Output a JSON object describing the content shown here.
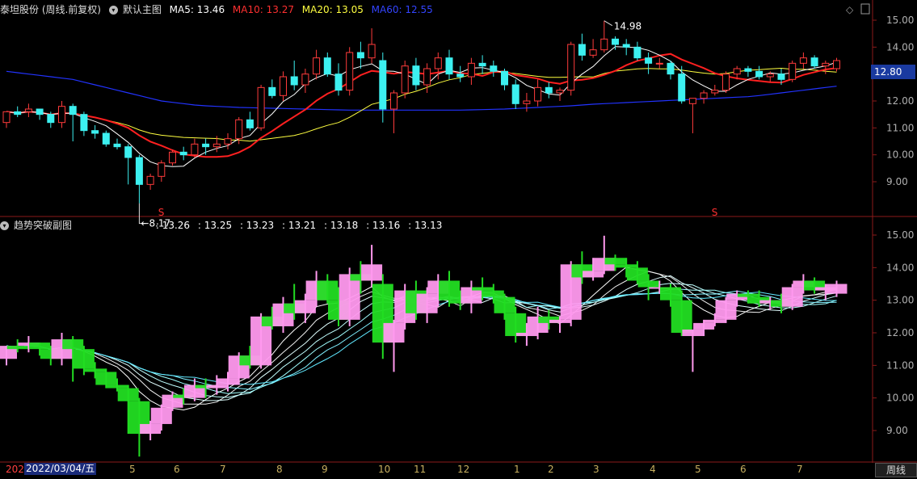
{
  "main_header": {
    "stock_title": "泰坦股份 (周线.前复权)",
    "chart_name": "默认主图",
    "ma5_label": "MA5: 13.46",
    "ma10_label": "MA10: 13.27",
    "ma20_label": "MA20: 13.05",
    "ma60_label": "MA60: 12.55"
  },
  "sub_header": {
    "title": "趋势突破副图",
    "values": [
      ": 13.26",
      ": 13.25",
      ": 13.23",
      ": 13.21",
      ": 13.18",
      ": 13.16",
      ": 13.13"
    ]
  },
  "annotations": {
    "high_label": "14.98",
    "low_label": "8.17",
    "marker": "S"
  },
  "current_price_tag": "12.80",
  "period_button": "周线",
  "date_axis": {
    "selected_date": "2022/03/04/五",
    "year_prefix": "202",
    "month_labels": [
      "5",
      "6",
      "7",
      "8",
      "9",
      "10",
      "11",
      "12",
      "1",
      "2",
      "3",
      "4",
      "5",
      "6",
      "7"
    ]
  },
  "colors": {
    "up": "#ff3b3b",
    "down": "#3cf0f0",
    "ma5": "#ffffff",
    "ma10": "#ff2020",
    "ma20": "#ffff40",
    "ma60": "#2233ff",
    "axis": "#8b1a1a",
    "sub_up": "#ff99ee",
    "sub_down": "#22dd22"
  },
  "chart_data": {
    "type": "candlestick",
    "main_y_ticks": [
      "15.00",
      "14.00",
      "13.00",
      "12.00",
      "11.00",
      "10.00",
      "9.00"
    ],
    "sub_y_ticks": [
      "15.00",
      "14.00",
      "13.00",
      "12.00",
      "11.00",
      "10.00",
      "9.00"
    ],
    "main_ylim": [
      8.0,
      15.6
    ],
    "candles": [
      [
        11.2,
        11.6,
        11.0,
        11.6
      ],
      [
        11.6,
        11.8,
        11.4,
        11.5
      ],
      [
        11.6,
        11.9,
        11.4,
        11.7
      ],
      [
        11.7,
        11.7,
        11.3,
        11.5
      ],
      [
        11.5,
        11.6,
        11.0,
        11.2
      ],
      [
        11.2,
        12.0,
        11.0,
        11.8
      ],
      [
        11.8,
        11.9,
        10.5,
        11.5
      ],
      [
        11.5,
        11.6,
        10.7,
        10.9
      ],
      [
        10.9,
        11.1,
        10.6,
        10.8
      ],
      [
        10.8,
        10.9,
        10.3,
        10.4
      ],
      [
        10.4,
        10.6,
        10.2,
        10.3
      ],
      [
        10.3,
        10.4,
        8.9,
        9.9
      ],
      [
        9.9,
        10.0,
        8.2,
        8.9
      ],
      [
        8.9,
        9.3,
        8.7,
        9.2
      ],
      [
        9.2,
        9.8,
        9.0,
        9.7
      ],
      [
        9.7,
        10.2,
        9.6,
        10.1
      ],
      [
        10.1,
        10.3,
        9.8,
        10.0
      ],
      [
        10.0,
        10.6,
        9.9,
        10.4
      ],
      [
        10.4,
        10.6,
        10.0,
        10.3
      ],
      [
        10.3,
        10.7,
        10.1,
        10.4
      ],
      [
        10.4,
        10.8,
        10.2,
        10.6
      ],
      [
        10.6,
        11.4,
        10.4,
        11.3
      ],
      [
        11.3,
        11.6,
        10.9,
        11.0
      ],
      [
        11.0,
        12.6,
        10.9,
        12.5
      ],
      [
        12.5,
        12.8,
        12.1,
        12.2
      ],
      [
        12.2,
        13.1,
        12.0,
        12.9
      ],
      [
        12.9,
        13.5,
        12.4,
        12.6
      ],
      [
        12.6,
        13.2,
        12.3,
        13.0
      ],
      [
        13.0,
        13.9,
        12.8,
        13.6
      ],
      [
        13.6,
        13.8,
        12.9,
        13.0
      ],
      [
        13.0,
        13.4,
        12.2,
        12.4
      ],
      [
        12.4,
        14.0,
        12.2,
        13.8
      ],
      [
        13.8,
        14.2,
        13.2,
        13.6
      ],
      [
        13.6,
        14.7,
        13.4,
        14.1
      ],
      [
        13.5,
        13.8,
        11.2,
        11.7
      ],
      [
        11.7,
        12.4,
        10.8,
        12.3
      ],
      [
        12.3,
        13.5,
        12.1,
        13.3
      ],
      [
        13.3,
        13.6,
        12.4,
        12.6
      ],
      [
        12.6,
        13.4,
        12.3,
        13.2
      ],
      [
        13.2,
        13.8,
        12.8,
        13.6
      ],
      [
        13.6,
        13.9,
        12.8,
        13.0
      ],
      [
        13.0,
        13.3,
        12.7,
        12.9
      ],
      [
        12.9,
        13.6,
        12.6,
        13.4
      ],
      [
        13.4,
        13.7,
        13.0,
        13.3
      ],
      [
        13.3,
        13.5,
        12.9,
        13.1
      ],
      [
        13.1,
        13.2,
        12.4,
        12.6
      ],
      [
        12.6,
        12.8,
        11.7,
        11.9
      ],
      [
        11.9,
        12.3,
        11.6,
        12.0
      ],
      [
        12.0,
        12.8,
        11.8,
        12.5
      ],
      [
        12.5,
        12.7,
        12.1,
        12.3
      ],
      [
        12.3,
        12.5,
        12.0,
        12.4
      ],
      [
        12.4,
        14.2,
        12.2,
        14.1
      ],
      [
        14.1,
        14.5,
        13.5,
        13.7
      ],
      [
        13.7,
        14.3,
        13.6,
        13.9
      ],
      [
        13.9,
        14.98,
        13.8,
        14.3
      ],
      [
        14.3,
        14.4,
        13.9,
        14.1
      ],
      [
        14.1,
        14.3,
        13.7,
        14.0
      ],
      [
        14.0,
        14.2,
        13.5,
        13.6
      ],
      [
        13.6,
        13.8,
        13.0,
        13.4
      ],
      [
        13.4,
        13.6,
        13.2,
        13.4
      ],
      [
        13.4,
        13.5,
        12.8,
        13.0
      ],
      [
        13.0,
        13.3,
        11.9,
        12.0
      ],
      [
        11.9,
        12.1,
        10.8,
        12.1
      ],
      [
        12.1,
        12.4,
        11.9,
        12.3
      ],
      [
        12.3,
        12.6,
        12.2,
        12.4
      ],
      [
        12.4,
        13.1,
        12.3,
        13.0
      ],
      [
        13.0,
        13.3,
        12.8,
        13.2
      ],
      [
        13.2,
        13.3,
        12.9,
        13.1
      ],
      [
        13.1,
        13.3,
        12.8,
        12.9
      ],
      [
        12.9,
        13.1,
        12.7,
        13.0
      ],
      [
        13.0,
        13.2,
        12.6,
        12.8
      ],
      [
        12.8,
        13.5,
        12.7,
        13.4
      ],
      [
        13.4,
        13.8,
        13.2,
        13.6
      ],
      [
        13.6,
        13.7,
        13.2,
        13.3
      ],
      [
        13.3,
        13.5,
        13.0,
        13.4
      ],
      [
        13.2,
        13.6,
        13.1,
        13.5
      ]
    ],
    "ma60": [
      13.1,
      13.05,
      13.0,
      12.95,
      12.9,
      12.85,
      12.8,
      12.7,
      12.6,
      12.5,
      12.4,
      12.3,
      12.2,
      12.1,
      12.0,
      11.95,
      11.9,
      11.85,
      11.82,
      11.8,
      11.78,
      11.76,
      11.75,
      11.74,
      11.73,
      11.72,
      11.71,
      11.7,
      11.69,
      11.68,
      11.67,
      11.66,
      11.66,
      11.66,
      11.66,
      11.66,
      11.66,
      11.66,
      11.66,
      11.66,
      11.66,
      11.66,
      11.67,
      11.68,
      11.69,
      11.7,
      11.72,
      11.74,
      11.76,
      11.78,
      11.8,
      11.82,
      11.85,
      11.88,
      11.9,
      11.92,
      11.94,
      11.96,
      11.98,
      12.0,
      12.02,
      12.04,
      12.06,
      12.08,
      12.1,
      12.12,
      12.14,
      12.16,
      12.2,
      12.25,
      12.3,
      12.35,
      12.4,
      12.45,
      12.5,
      12.55
    ],
    "high_mark_index": 54,
    "low_mark_index": 12
  }
}
